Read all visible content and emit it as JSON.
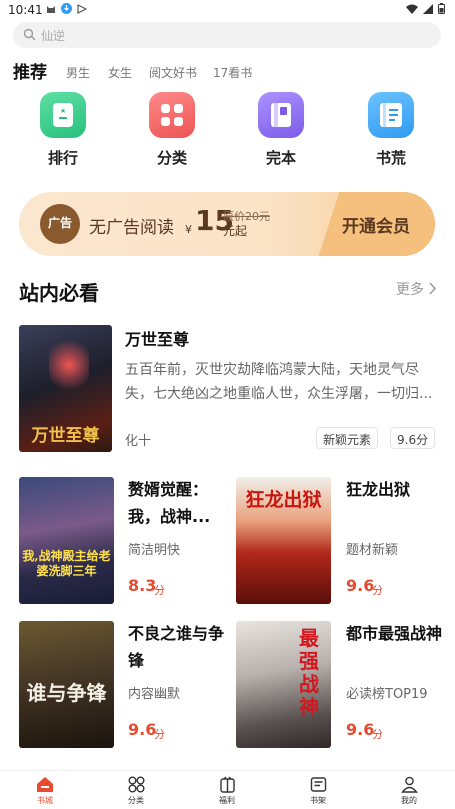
{
  "status_bar": {
    "time": "10:41"
  },
  "search": {
    "placeholder": "仙逆"
  },
  "tabs": {
    "active": "推荐",
    "items": [
      "男生",
      "女生",
      "阅文好书",
      "17看书"
    ]
  },
  "categories": [
    {
      "label": "排行",
      "icon": "trophy-icon",
      "color": "#3ccf8e"
    },
    {
      "label": "分类",
      "icon": "grid-icon",
      "color": "#f26a6a"
    },
    {
      "label": "完本",
      "icon": "book-icon",
      "color": "#8f72f0"
    },
    {
      "label": "书荒",
      "icon": "notebook-icon",
      "color": "#3aa7f5"
    }
  ],
  "vip_banner": {
    "logo_text": "广告",
    "text": "无广告阅读",
    "currency": "¥",
    "price": "15",
    "original_price": "原价20元",
    "suffix": "元起",
    "button": "开通会员"
  },
  "section": {
    "title": "站内必看",
    "more": "更多"
  },
  "featured": {
    "title": "万世至尊",
    "cover_text": "万世至尊",
    "description": "五百年前，灭世灾劫降临鸿蒙大陆，天地灵气尽失，七大绝凶之地重临人世，众生浮屠，一切归...",
    "author": "化十",
    "tags": [
      "新颖元素",
      "9.6分"
    ]
  },
  "books": [
    {
      "title": "赘婿觉醒：我，战神...",
      "subtitle": "简洁明快",
      "score": "8.3",
      "unit": "分",
      "cover_text": "我,战神殿主给老婆洗脚三年"
    },
    {
      "title": "狂龙出狱",
      "subtitle": "题材新颖",
      "score": "9.6",
      "unit": "分",
      "cover_text": "狂龙出狱"
    },
    {
      "title": "不良之谁与争锋",
      "subtitle": "内容幽默",
      "score": "9.6",
      "unit": "分",
      "cover_text": "谁与争锋"
    },
    {
      "title": "都市最强战神",
      "subtitle": "必读榜TOP19",
      "score": "9.6",
      "unit": "分",
      "cover_text": "最强战神"
    }
  ],
  "bottom_nav": [
    {
      "label": "书城",
      "icon": "home-icon",
      "active": true
    },
    {
      "label": "分类",
      "icon": "category-icon",
      "active": false
    },
    {
      "label": "福利",
      "icon": "gift-icon",
      "active": false
    },
    {
      "label": "书架",
      "icon": "bookshelf-icon",
      "active": false
    },
    {
      "label": "我的",
      "icon": "profile-icon",
      "active": false
    }
  ],
  "colors": {
    "accent": "#e84a2f",
    "vip_text": "#5b3920"
  }
}
